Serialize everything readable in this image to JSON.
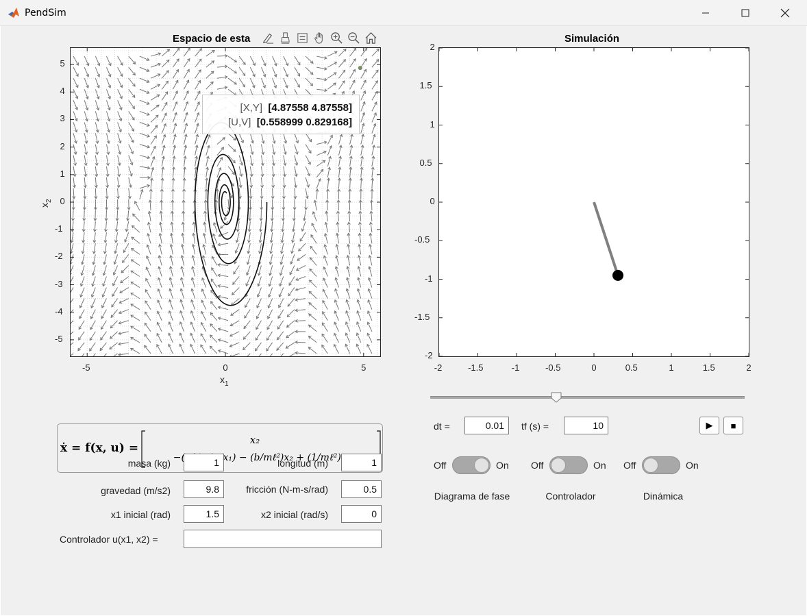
{
  "window": {
    "title": "PendSim",
    "icon": "matlab-icon"
  },
  "phase_plot": {
    "title_visible": "Espacio de esta",
    "toolbar_icons": [
      "brush-icon",
      "data-tips-icon",
      "legend-icon",
      "pan-icon",
      "zoom-in-icon",
      "zoom-out-icon",
      "home-icon"
    ],
    "xlabel": "x",
    "xlabel_sub": "1",
    "ylabel": "x",
    "ylabel_sub": "2",
    "xticks": [
      "-5",
      "0",
      "5"
    ],
    "yticks": [
      "5",
      "4",
      "3",
      "2",
      "1",
      "0",
      "-1",
      "-2",
      "-3",
      "-4",
      "-5"
    ],
    "datatip": {
      "xy_label": "[X,Y]",
      "xy_value": "[4.87558  4.87558]",
      "uv_label": "[U,V]",
      "uv_value": "[0.558999  0.829168]"
    }
  },
  "sim_plot": {
    "title": "Simulación",
    "xticks": [
      "-2",
      "-1.5",
      "-1",
      "-0.5",
      "0",
      "0.5",
      "1",
      "1.5",
      "2"
    ],
    "yticks": [
      "2",
      "1.5",
      "1",
      "0.5",
      "0",
      "-0.5",
      "-1",
      "-1.5",
      "-2"
    ]
  },
  "chart_data": [
    {
      "type": "scatter",
      "title": "Espacio de estados",
      "xlabel": "x1",
      "ylabel": "x2",
      "xlim": [
        -5.6,
        5.6
      ],
      "ylim": [
        -5.6,
        5.6
      ],
      "grid": true,
      "quiver_field": "x1' = x2, x2' = -9.8 sin(x1) - 0.5 x2",
      "trajectory_start": [
        1.5,
        0
      ],
      "datatip": {
        "x": 4.87558,
        "y": 4.87558,
        "u": 0.558999,
        "v": 0.829168
      }
    },
    {
      "type": "line",
      "title": "Simulación",
      "xlim": [
        -2,
        2
      ],
      "ylim": [
        -2,
        2
      ],
      "pendulum": {
        "pivot": [
          0,
          0
        ],
        "bob": [
          0.31,
          -0.95
        ]
      }
    }
  ],
  "equation": {
    "lhs": "ẋ = f(x, u) =",
    "row1": "x₂",
    "row2": "−(g/ℓ) sin(x₁) − (b/mℓ²)x₂ + (1/mℓ²) u"
  },
  "params": {
    "masa_label": "masa (kg)",
    "masa": "1",
    "longitud_label": "longitud (m)",
    "longitud": "1",
    "gravedad_label": "gravedad (m/s2)",
    "gravedad": "9.8",
    "friccion_label": "fricción (N-m-s/rad)",
    "friccion": "0.5",
    "x1_label": "x1 inicial (rad)",
    "x1": "1.5",
    "x2_label": "x2 inicial (rad/s)",
    "x2": "0",
    "ctrl_label": "Controlador u(x1, x2) =",
    "ctrl": ""
  },
  "sim_controls": {
    "slider_value": 0.4,
    "dt_label": "dt =",
    "dt": "0.01",
    "tf_label": "tf (s) =",
    "tf": "10",
    "play_glyph": "▶",
    "stop_glyph": "■"
  },
  "switches": [
    {
      "off": "Off",
      "on": "On",
      "caption": "Diagrama de fase",
      "state": "on"
    },
    {
      "off": "Off",
      "on": "On",
      "caption": "Controlador",
      "state": "off"
    },
    {
      "off": "Off",
      "on": "On",
      "caption": "Dinámica",
      "state": "off"
    }
  ]
}
